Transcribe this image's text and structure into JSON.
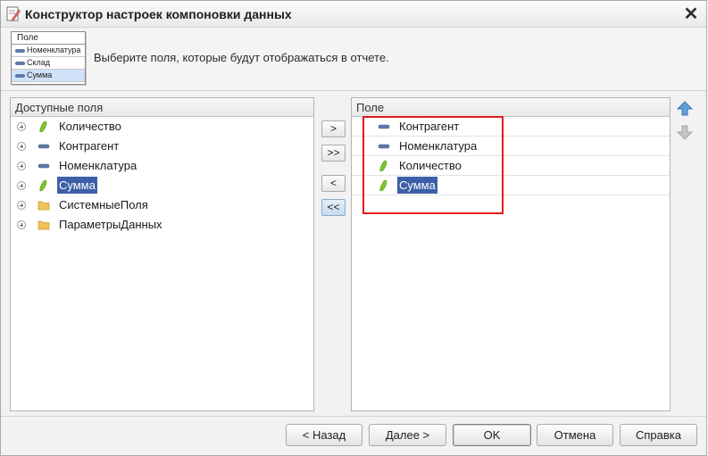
{
  "window": {
    "title": "Конструктор настроек компоновки данных",
    "close_glyph": "✕"
  },
  "header": {
    "instruction": "Выберите поля, которые будут отображаться в отчете.",
    "thumbnail": {
      "head": "Поле",
      "rows": [
        "Номенклатура",
        "Склад",
        "Сумма"
      ]
    }
  },
  "available_fields": {
    "header": "Доступные поля",
    "items": [
      {
        "label": "Количество",
        "icon": "resource-icon",
        "expandable": true,
        "selected": false
      },
      {
        "label": "Контрагент",
        "icon": "dimension-icon",
        "expandable": true,
        "selected": false
      },
      {
        "label": "Номенклатура",
        "icon": "dimension-icon",
        "expandable": true,
        "selected": false
      },
      {
        "label": "Сумма",
        "icon": "resource-icon",
        "expandable": true,
        "selected": true
      },
      {
        "label": "СистемныеПоля",
        "icon": "folder-icon",
        "expandable": true,
        "selected": false
      },
      {
        "label": "ПараметрыДанных",
        "icon": "folder-icon",
        "expandable": true,
        "selected": false
      }
    ]
  },
  "move_buttons": {
    "add": ">",
    "add_all": ">>",
    "remove": "<",
    "remove_all": "<<"
  },
  "selected_fields": {
    "header": "Поле",
    "items": [
      {
        "label": "Контрагент",
        "icon": "dimension-icon",
        "selected": false
      },
      {
        "label": "Номенклатура",
        "icon": "dimension-icon",
        "selected": false
      },
      {
        "label": "Количество",
        "icon": "resource-icon",
        "selected": false
      },
      {
        "label": "Сумма",
        "icon": "resource-icon",
        "selected": true
      }
    ]
  },
  "footer": {
    "back": "< Назад",
    "next": "Далее >",
    "ok": "OK",
    "cancel": "Отмена",
    "help": "Справка"
  },
  "colors": {
    "selection": "#3d5fa8",
    "highlight_box": "#e01b1b",
    "resource_icon": "#7cc52a",
    "dimension_icon": "#5d7aa8",
    "folder_icon": "#f0c35a"
  }
}
